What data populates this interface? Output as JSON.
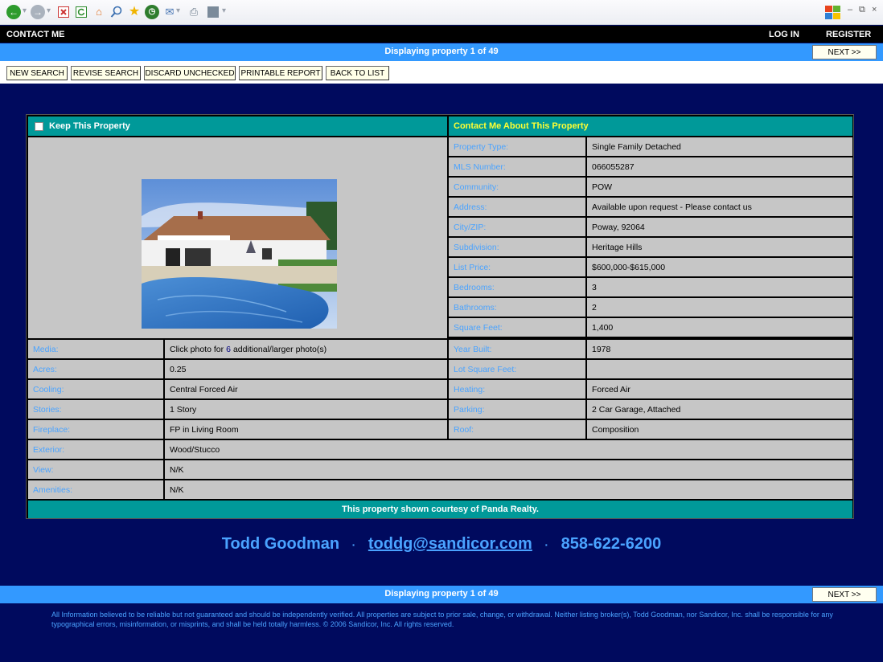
{
  "browser": {
    "toolbar_icons": [
      "back-icon",
      "forward-icon",
      "stop-icon",
      "refresh-icon",
      "home-icon",
      "search-icon",
      "favorites-icon",
      "history-icon",
      "mail-icon",
      "print-icon",
      "edit-icon"
    ]
  },
  "topnav": {
    "contact": "CONTACT ME",
    "login": "LOG IN",
    "register": "REGISTER"
  },
  "status": {
    "prefix": "Displaying property ",
    "current": "1",
    "of": " of ",
    "total": "49",
    "next": "NEXT >>"
  },
  "actions": [
    "NEW SEARCH",
    "REVISE SEARCH",
    "DISCARD UNCHECKED",
    "PRINTABLE REPORT",
    "BACK TO LIST"
  ],
  "property": {
    "keep_label": "Keep This Property",
    "contact_label": "Contact Me About This Property",
    "right_details": [
      {
        "label": "Property Type:",
        "value": "Single Family Detached"
      },
      {
        "label": "MLS Number:",
        "value": "066055287"
      },
      {
        "label": "Community:",
        "value": "POW"
      },
      {
        "label": "Address:",
        "value": "Available upon request - Please contact us"
      },
      {
        "label": "City/ZIP:",
        "value": "Poway, 92064"
      },
      {
        "label": "Subdivision:",
        "value": "Heritage Hills"
      },
      {
        "label": "List Price:",
        "value": "$600,000-$615,000"
      },
      {
        "label": "Bedrooms:",
        "value": "3"
      },
      {
        "label": "Bathrooms:",
        "value": "2"
      },
      {
        "label": "Square Feet:",
        "value": "1,400"
      }
    ],
    "media": {
      "label": "Media:",
      "value_prefix": "Click photo for ",
      "photo_count": "6",
      "value_suffix": " additional/larger photo(s)"
    },
    "paired_rows": [
      {
        "left_label": "Acres:",
        "left_value": "0.25",
        "right_label": "Lot Square Feet:",
        "right_value": ""
      },
      {
        "left_label": "Cooling:",
        "left_value": "Central Forced Air",
        "right_label": "Heating:",
        "right_value": "Forced Air"
      },
      {
        "left_label": "Stories:",
        "left_value": "1 Story",
        "right_label": "Parking:",
        "right_value": "2 Car Garage, Attached"
      },
      {
        "left_label": "Fireplace:",
        "left_value": "FP in Living Room",
        "right_label": "Roof:",
        "right_value": "Composition"
      }
    ],
    "year_built": {
      "label": "Year Built:",
      "value": "1978"
    },
    "full_rows": [
      {
        "label": "Exterior:",
        "value": "Wood/Stucco"
      },
      {
        "label": "View:",
        "value": "N/K"
      },
      {
        "label": "Amenities:",
        "value": "N/K"
      }
    ],
    "courtesy": "This property shown courtesy of Panda Realty."
  },
  "agent": {
    "name": "Todd Goodman",
    "separator": "·",
    "email": "toddg@sandicor.com",
    "phone": "858-622-6200"
  },
  "disclaimer": "All Information believed to be reliable but not guaranteed and should be independently verified. All properties are subject to prior sale, change, or withdrawal. Neither listing broker(s), Todd Goodman, nor Sandicor, Inc. shall be responsible for any typographical errors, misinformation, or misprints, and shall be held totally harmless. © 2006 Sandicor, Inc. All rights reserved."
}
